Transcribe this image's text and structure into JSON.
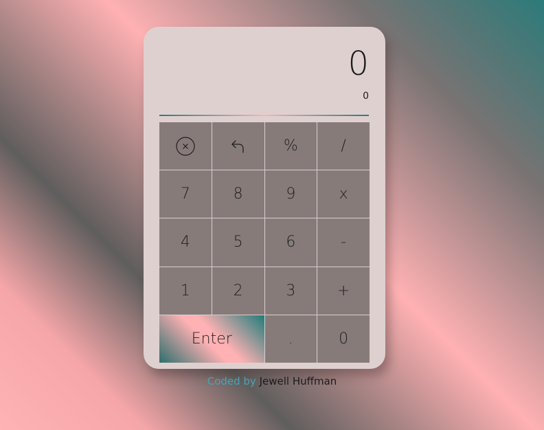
{
  "display": {
    "result": "0",
    "expression": "0"
  },
  "keys": [
    {
      "label": "",
      "icon": "clear-circle-icon"
    },
    {
      "label": "",
      "icon": "undo-icon"
    },
    {
      "label": "%"
    },
    {
      "label": "/"
    },
    {
      "label": "7"
    },
    {
      "label": "8"
    },
    {
      "label": "9"
    },
    {
      "label": "x"
    },
    {
      "label": "4"
    },
    {
      "label": "5"
    },
    {
      "label": "6"
    },
    {
      "label": "-"
    },
    {
      "label": "1"
    },
    {
      "label": "2"
    },
    {
      "label": "3"
    },
    {
      "label": "+"
    },
    {
      "label": "Enter"
    },
    {
      "label": "."
    },
    {
      "label": "0"
    }
  ],
  "footer": {
    "prefix": "Coded by",
    "author": "Jewell Huffman"
  },
  "colors": {
    "calculator_bg": "#dfd0d0",
    "key_bg": "#877b7a",
    "accent_teal": "#2c7b7a",
    "accent_pink": "#ffb1b3",
    "footer_link": "#4aa3b8"
  }
}
